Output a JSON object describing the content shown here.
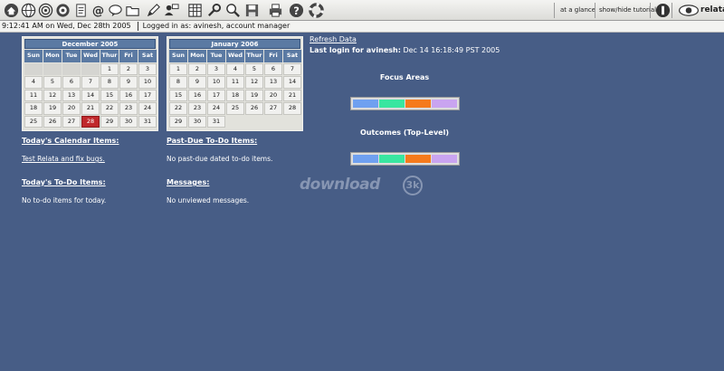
{
  "toolbar": {
    "icons": [
      "home-icon",
      "globe-icon",
      "target-icon",
      "notepad-icon",
      "at-icon",
      "chat-icon",
      "folder-icon",
      "pen-icon",
      "user-chat-icon",
      "grid-icon",
      "wrench-icon",
      "magnifier-icon",
      "save-icon",
      "print-icon",
      "help-icon",
      "lifebuoy-icon"
    ],
    "links": {
      "at_a_glance": "at a glance",
      "show_hide_tutorial": "show/hide tutorial"
    },
    "brand": "relata"
  },
  "status": {
    "time": "9:12:41 AM on Wed, Dec 28th 2005",
    "logged_in": "Logged in as: avinesh, account manager"
  },
  "calendars": [
    {
      "title": "December 2005",
      "days": [
        "Sun",
        "Mon",
        "Tue",
        "Wed",
        "Thur",
        "Fri",
        "Sat"
      ],
      "cells": [
        "",
        "",
        "",
        "",
        "1",
        "2",
        "3",
        "4",
        "5",
        "6",
        "7",
        "8",
        "9",
        "10",
        "11",
        "12",
        "13",
        "14",
        "15",
        "16",
        "17",
        "18",
        "19",
        "20",
        "21",
        "22",
        "23",
        "24",
        "25",
        "26",
        "27",
        "28",
        "29",
        "30",
        "31"
      ],
      "today": "28"
    },
    {
      "title": "January 2006",
      "days": [
        "Sun",
        "Mon",
        "Tue",
        "Wed",
        "Thur",
        "Fri",
        "Sat"
      ],
      "cells": [
        "1",
        "2",
        "3",
        "4",
        "5",
        "6",
        "7",
        "8",
        "9",
        "10",
        "11",
        "12",
        "13",
        "14",
        "15",
        "16",
        "17",
        "18",
        "19",
        "20",
        "21",
        "22",
        "23",
        "24",
        "25",
        "26",
        "27",
        "28",
        "29",
        "30",
        "31"
      ],
      "today": ""
    }
  ],
  "sections": {
    "calendar_items": {
      "title": "Today's Calendar Items:",
      "item": "Test Relata and fix bugs."
    },
    "past_due": {
      "title": "Past-Due To-Do Items:",
      "text": "No past-due dated to-do items."
    },
    "todo": {
      "title": "Today's To-Do Items:",
      "text": "No to-do items for today."
    },
    "messages": {
      "title": "Messages:",
      "text": "No unviewed messages."
    }
  },
  "info": {
    "refresh": "Refresh Data",
    "last_login_label": "Last login for avinesh:",
    "last_login_value": "Dec 14 16:18:49 PST 2005"
  },
  "focus": {
    "title": "Focus Areas",
    "colors": [
      "#6fa0f0",
      "#39e6a0",
      "#f57a1c",
      "#c9a4f0"
    ]
  },
  "outcomes": {
    "title": "Outcomes (Top-Level)",
    "colors": [
      "#6fa0f0",
      "#39e6a0",
      "#f57a1c",
      "#c9a4f0"
    ]
  },
  "watermark": {
    "text": "download",
    "badge": "3k"
  }
}
